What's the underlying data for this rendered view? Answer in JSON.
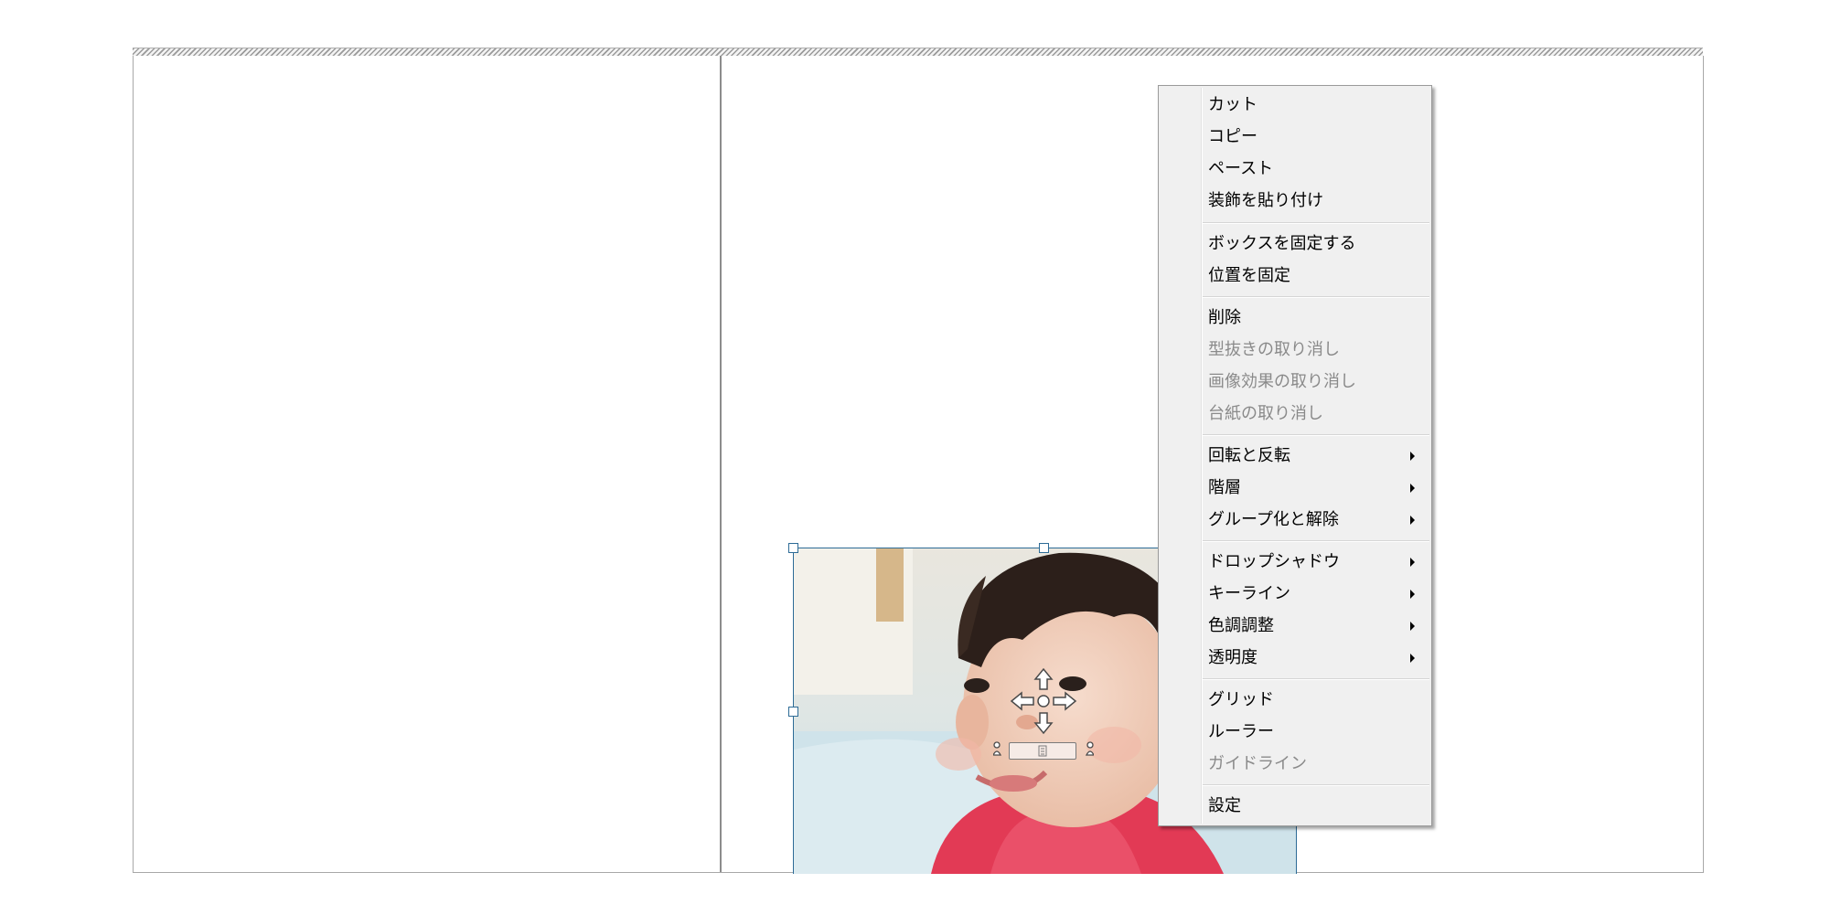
{
  "context_menu": {
    "cut": "カット",
    "copy": "コピー",
    "paste": "ペースト",
    "paste_decoration": "装飾を貼り付け",
    "fix_box": "ボックスを固定する",
    "fix_position": "位置を固定",
    "delete": "削除",
    "undo_cutout": "型抜きの取り消し",
    "undo_image_effect": "画像効果の取り消し",
    "undo_mount": "台紙の取り消し",
    "rotate_flip": "回転と反転",
    "layer": "階層",
    "group_ungroup": "グループ化と解除",
    "drop_shadow": "ドロップシャドウ",
    "keyline": "キーライン",
    "color_adjust": "色調調整",
    "transparency": "透明度",
    "grid": "グリッド",
    "ruler": "ルーラー",
    "guideline": "ガイドライン",
    "settings": "設定"
  },
  "icons": {
    "submenu": "chevron-right-icon",
    "move": "move-arrows-icon",
    "text_tab": "text-frame-icon",
    "person_left": "person-icon",
    "person_right": "person-icon"
  },
  "colors": {
    "selection_frame": "#2d6b96",
    "menu_background": "#f0f0f0",
    "disabled_text": "#8a8a8a"
  }
}
